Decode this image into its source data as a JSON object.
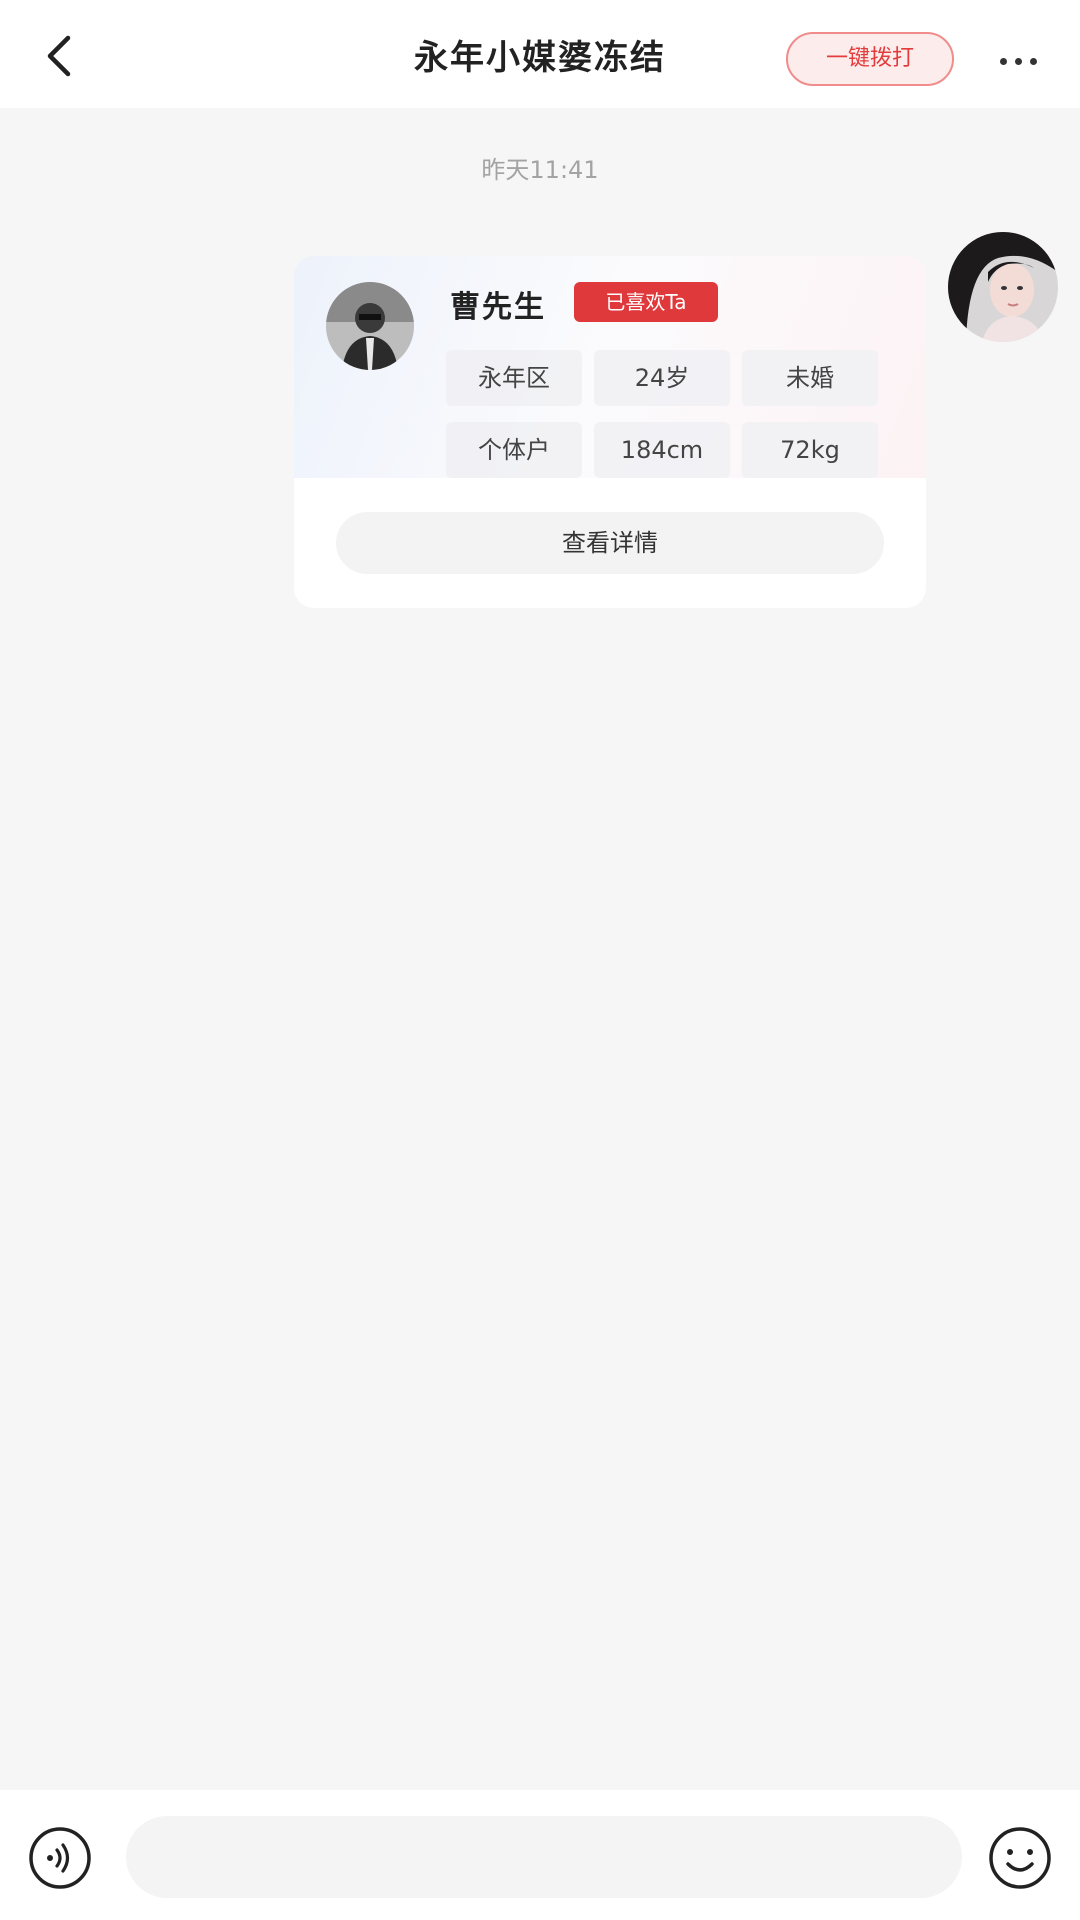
{
  "header": {
    "title": "永年小媒婆冻结",
    "call_button_label": "一键拨打",
    "back_icon": "chevron-left-icon",
    "more_icon": "more-horizontal-icon"
  },
  "timestamp": "昨天11:41",
  "profile_card": {
    "name": "曹先生",
    "badge": "已喜欢Ta",
    "info": [
      [
        "永年区",
        "24岁",
        "未婚"
      ],
      [
        "个体户",
        "184cm",
        "72kg"
      ]
    ],
    "detail_button_label": "查看详情"
  },
  "input_bar": {
    "message_value": "",
    "voice_icon": "voice-icon",
    "emoji_icon": "emoji-icon"
  },
  "colors": {
    "accent_red": "#e0393c",
    "background": "#f6f6f6"
  }
}
